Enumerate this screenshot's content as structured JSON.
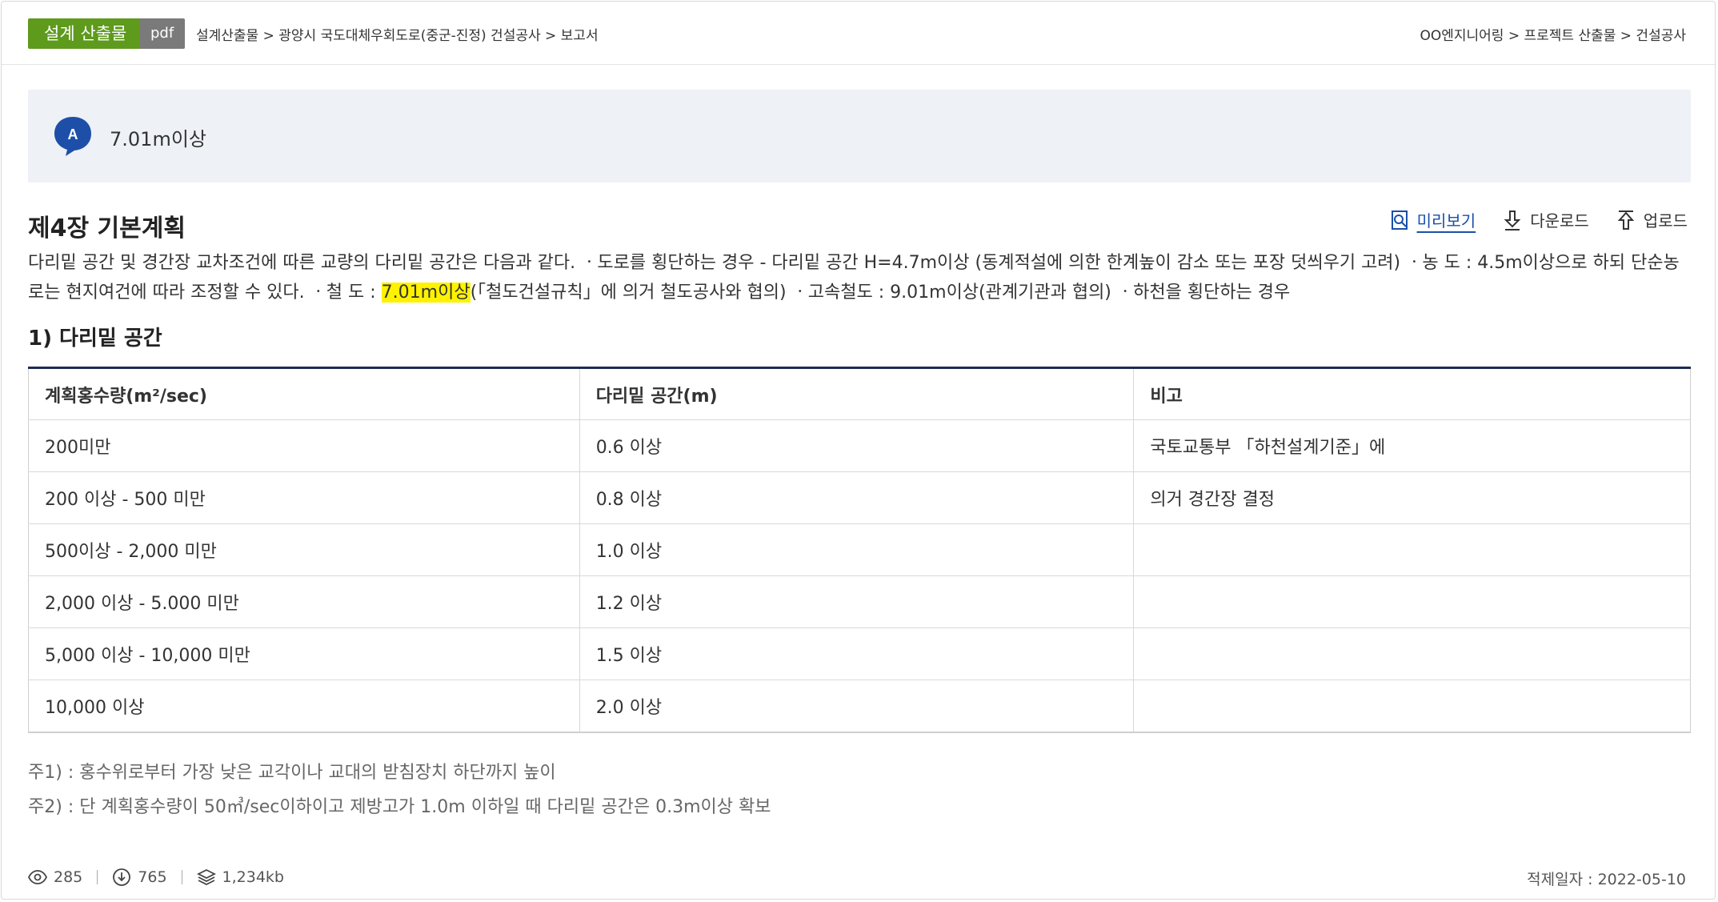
{
  "topbar": {
    "tag_primary": "설계 산출물",
    "tag_type": "pdf",
    "breadcrumb_left": "설계산출물 > 광양시 국도대체우회도로(중군-진정) 건설공사 > 보고서",
    "breadcrumb_right": "OO엔지니어링 > 프로젝트 산출물 > 건설공사"
  },
  "answer": {
    "icon_letter": "A",
    "text": "7.01m이상"
  },
  "document": {
    "chapter_title": "제4장 기본계획",
    "actions": {
      "preview": "미리보기",
      "download": "다운로드",
      "upload": "업로드"
    },
    "para_before": "다리밑 공간 및 경간장 교차조건에 따른 교량의 다리밑 공간은 다음과 같다. ㆍ도로를 횡단하는 경우 - 다리밑 공간 H=4.7m이상 (동계적설에 의한 한계높이 감소 또는 포장 덧씌우기 고려) ㆍ농 도 : 4.5m이상으로 하되 단순농로는 현지여건에 따라 조정할 수 있다. ㆍ철 도 : ",
    "para_highlight": "7.01m이상",
    "para_after": "(「철도건설규칙」에 의거 철도공사와 협의) ㆍ고속철도 : 9.01m이상(관계기관과 협의) ㆍ하천을 횡단하는 경우",
    "section_title": "1) 다리밑 공간"
  },
  "table": {
    "headers": [
      "계획홍수량(m²/sec)",
      "다리밑 공간(m)",
      "비고"
    ],
    "rows": [
      [
        "200미만",
        "0.6 이상",
        "국토교통부 「하천설계기준」에"
      ],
      [
        "200 이상 - 500 미만",
        "0.8 이상",
        "의거 경간장 결정"
      ],
      [
        "500이상 - 2,000 미만",
        "1.0 이상",
        ""
      ],
      [
        "2,000 이상 - 5.000 미만",
        "1.2 이상",
        ""
      ],
      [
        "5,000 이상 - 10,000 미만",
        "1.5 이상",
        ""
      ],
      [
        "10,000 이상",
        "2.0 이상",
        ""
      ]
    ]
  },
  "notes": {
    "note1": "주1) : 홍수위로부터 가장 낮은 교각이나 교대의 받침장치 하단까지 높이",
    "note2": "주2) : 단 계획홍수량이 50㎥/sec이하이고 제방고가 1.0m 이하일 때 다리밑 공간은 0.3m이상 확보"
  },
  "footer": {
    "views": "285",
    "downloads": "765",
    "size": "1,234kb",
    "date": "적제일자 : 2022-05-10"
  },
  "colors": {
    "tag_primary_bg": "#5e9a1c",
    "tag_type_bg": "#7a7a7a",
    "answer_bg": "#eef1f6",
    "answer_icon": "#1e4fa8",
    "link": "#1a4fa8",
    "highlight": "#fff200",
    "table_top_border": "#1d2b55"
  }
}
